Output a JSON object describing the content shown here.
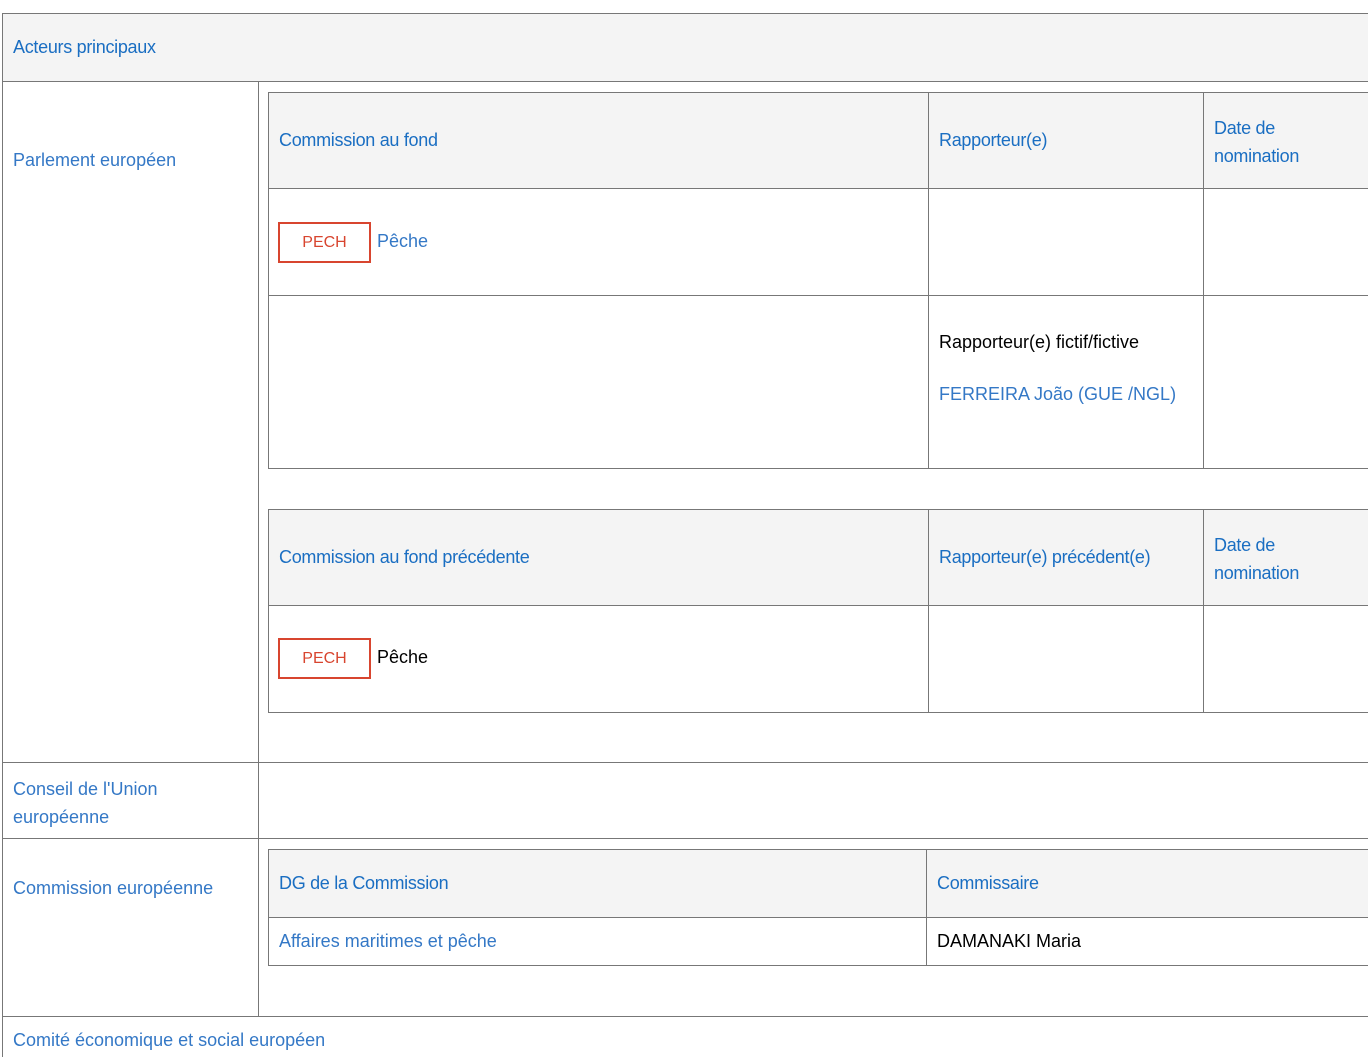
{
  "section_title": "Acteurs principaux",
  "actors": {
    "parliament": "Parlement européen",
    "council": "Conseil de l'Union européenne",
    "commission": "Commission européenne",
    "eesc": "Comité économique et social européen"
  },
  "ep_table": {
    "headers": [
      "Commission au fond",
      "Rapporteur(e)",
      "Date de nomination"
    ],
    "committee": {
      "code": "PECH",
      "name": "Pêche"
    },
    "shadow_label": "Rapporteur(e) fictif/fictive",
    "shadow_name": "FERREIRA João (GUE /NGL)"
  },
  "ep_prev_table": {
    "headers": [
      "Commission au fond précédente",
      "Rapporteur(e) précédent(e)",
      "Date de nomination"
    ],
    "committee": {
      "code": "PECH",
      "name": "Pêche"
    }
  },
  "com_table": {
    "headers": [
      "DG de la Commission",
      "Commissaire"
    ],
    "dg": "Affaires maritimes et pêche",
    "commissioner": "DAMANAKI Maria"
  },
  "colors": {
    "link": "#3478c6",
    "header": "#1a6ec2",
    "badge": "#d8452f",
    "header_bg": "#f4f4f4",
    "border": "#777777"
  }
}
